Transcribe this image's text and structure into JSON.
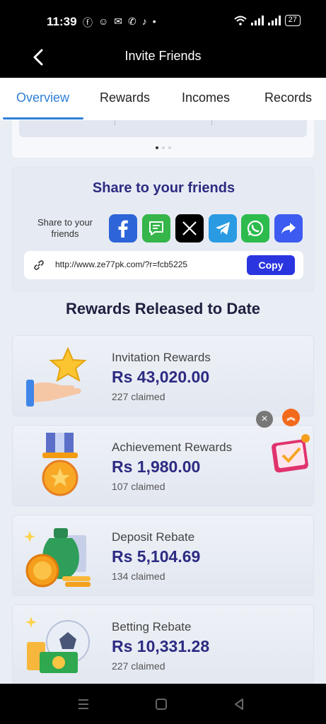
{
  "status": {
    "time": "11:39",
    "battery": "27",
    "left_icons": [
      "facebook-icon",
      "snapchat-icon",
      "messenger-icon",
      "phone-icon",
      "tiktok-icon",
      "dot-icon"
    ],
    "right_icons": [
      "wifi-icon",
      "signal-icon",
      "signal-icon"
    ]
  },
  "header": {
    "title": "Invite Friends"
  },
  "tabs": [
    {
      "label": "Overview",
      "active": true
    },
    {
      "label": "Rewards",
      "active": false
    },
    {
      "label": "Incomes",
      "active": false
    },
    {
      "label": "Records",
      "active": false
    }
  ],
  "banner": {
    "pages": 3,
    "current": 1
  },
  "share": {
    "title": "Share to your friends",
    "label": "Share to your friends",
    "icons": [
      "facebook-icon",
      "message-icon",
      "x-icon",
      "telegram-icon",
      "whatsapp-icon",
      "forward-icon"
    ],
    "link": "http://www.ze77pk.com/?r=fcb5225",
    "copy_label": "Copy"
  },
  "rewards_section": {
    "title": "Rewards Released to Date",
    "items": [
      {
        "name": "Invitation Rewards",
        "amount": "Rs  43,020.00",
        "claimed": "227 claimed",
        "icon": "star-hand-icon"
      },
      {
        "name": "Achievement Rewards",
        "amount": "Rs  1,980.00",
        "claimed": "107 claimed",
        "icon": "medal-icon"
      },
      {
        "name": "Deposit Rebate",
        "amount": "Rs  5,104.69",
        "claimed": "134 claimed",
        "icon": "money-bag-icon"
      },
      {
        "name": "Betting Rebate",
        "amount": "Rs  10,331.28",
        "claimed": "227 claimed",
        "icon": "football-cash-icon"
      }
    ]
  },
  "floating": {
    "close": "×",
    "up": "︽"
  }
}
